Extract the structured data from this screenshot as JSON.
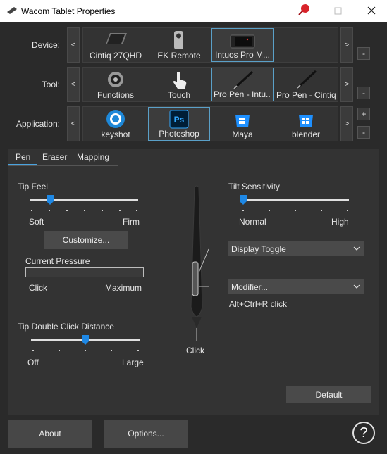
{
  "window": {
    "title": "Wacom Tablet Properties"
  },
  "rows": {
    "device": {
      "label": "Device:",
      "items": [
        "Cintiq 27QHD",
        "EK Remote",
        "Intuos Pro M..."
      ],
      "selected": 2,
      "left_arrow": "<",
      "right_arrow": ">",
      "remove": "-"
    },
    "tool": {
      "label": "Tool:",
      "items": [
        "Functions",
        "Touch",
        "Pro Pen - Intu...",
        "Pro Pen - Cintiq"
      ],
      "selected": 2,
      "left_arrow": "<",
      "right_arrow": ">",
      "remove": "-"
    },
    "application": {
      "label": "Application:",
      "items": [
        "keyshot",
        "Photoshop",
        "Maya",
        "blender"
      ],
      "selected": 1,
      "left_arrow": "<",
      "right_arrow": ">",
      "add": "+",
      "remove": "-"
    }
  },
  "tabs": [
    "Pen",
    "Eraser",
    "Mapping"
  ],
  "active_tab": "Pen",
  "pen": {
    "tip_feel": {
      "label": "Tip Feel",
      "min": "Soft",
      "max": "Firm",
      "value_fraction": 0.18,
      "customize": "Customize..."
    },
    "current_pressure": {
      "label": "Current Pressure",
      "min": "Click",
      "max": "Maximum",
      "value_fraction": 0
    },
    "tip_double_click": {
      "label": "Tip Double Click Distance",
      "min": "Off",
      "max": "Large",
      "value_fraction": 0.5
    },
    "tilt": {
      "label": "Tilt Sensitivity",
      "min": "Normal",
      "max": "High",
      "value_fraction": 0.0
    },
    "upper_button": "Display Toggle",
    "lower_button": "Modifier...",
    "lower_button_detail": "Alt+Ctrl+R click",
    "tip_action": "Click",
    "default": "Default"
  },
  "footer": {
    "about": "About",
    "options": "Options...",
    "help": "?"
  },
  "colors": {
    "selection_border": "#5aa0c8",
    "tab_accent": "#4aa3df",
    "ps_bg": "#001e36",
    "ps_blue": "#31a8ff",
    "win_blue": "#1e90ff"
  }
}
